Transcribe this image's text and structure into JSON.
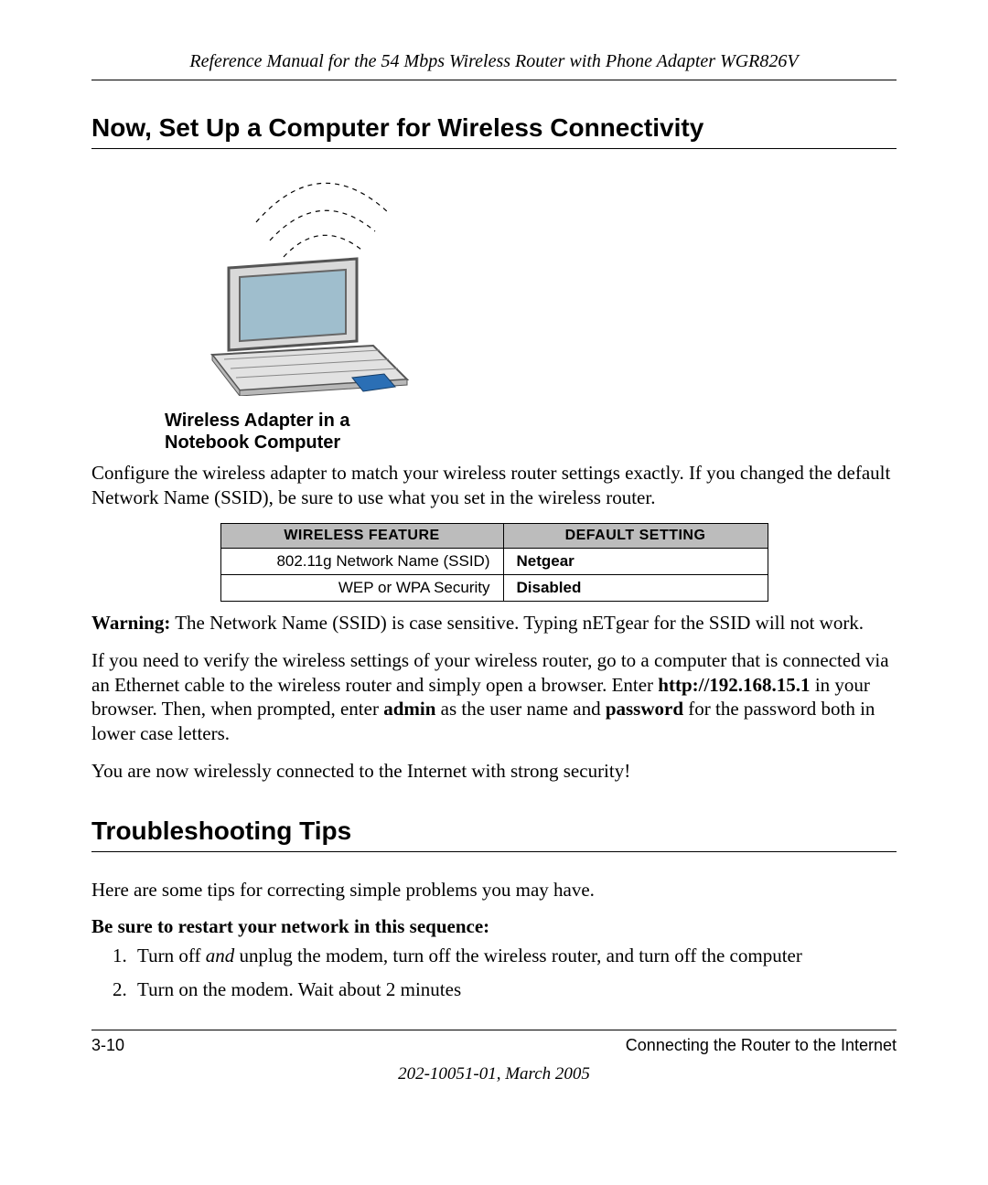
{
  "running_head": "Reference Manual for the 54 Mbps Wireless Router with Phone Adapter WGR826V",
  "section1_title": "Now, Set Up a Computer for Wireless Connectivity",
  "figure_caption_line1": "Wireless Adapter in a",
  "figure_caption_line2": "Notebook Computer",
  "para1": "Configure the wireless adapter to match your wireless router settings exactly. If you changed the default Network Name (SSID), be sure to use what you set in the wireless router.",
  "table": {
    "headers": {
      "col1": "Wireless Feature",
      "col2": "Default Setting"
    },
    "rows": [
      {
        "feature": "802.11g Network Name (SSID)",
        "value": "Netgear"
      },
      {
        "feature": "WEP or WPA Security",
        "value": "Disabled"
      }
    ]
  },
  "warning_label": "Warning:",
  "warning_text": " The Network Name (SSID) is case sensitive. Typing nETgear for the SSID will not work.",
  "para3_a": "If you need to verify the wireless settings of your wireless router, go to a computer that is connected via an Ethernet cable to the wireless router and simply open a browser. Enter ",
  "para3_url": "http://192.168.15.1",
  "para3_b": " in your browser. Then, when prompted, enter ",
  "para3_admin": "admin",
  "para3_c": " as the user name and ",
  "para3_password": "password",
  "para3_d": " for the password both in lower case letters.",
  "para4": "You are now wirelessly connected to the Internet with strong security!",
  "section2_title": "Troubleshooting Tips",
  "para5": "Here are some tips for correcting simple problems you may have.",
  "subhead": "Be sure to restart your network in this sequence:",
  "step1_a": "Turn off ",
  "step1_and": "and",
  "step1_b": " unplug the modem, turn off the wireless router, and turn off the computer",
  "step2": "Turn on the modem. Wait about 2 minutes",
  "footer": {
    "page_num": "3-10",
    "chapter": "Connecting the Router to the Internet",
    "docid": "202-10051-01, March 2005"
  }
}
